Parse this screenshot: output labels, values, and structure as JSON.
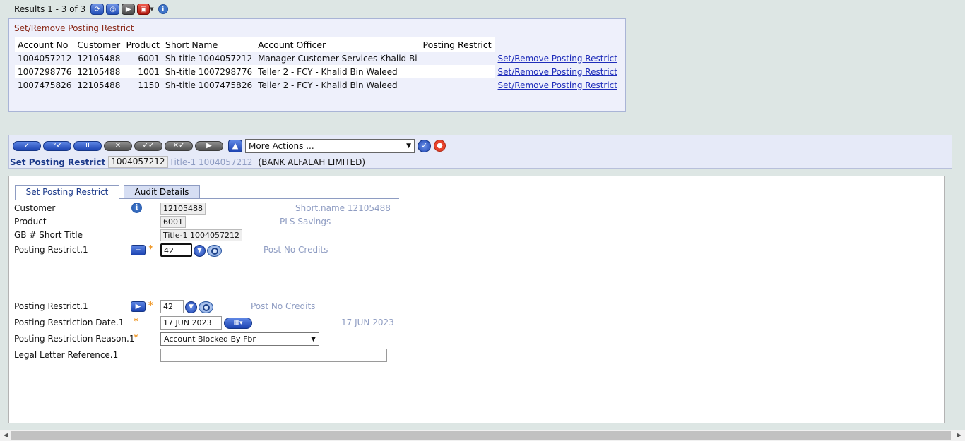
{
  "results": {
    "text": "Results 1 - 3 of 3",
    "icons": [
      "refresh-icon",
      "search-icon",
      "next-icon",
      "tools-icon",
      "info-icon"
    ]
  },
  "enquiry": {
    "title": "Set/Remove Posting Restrict",
    "columns": [
      "Account No",
      "Customer",
      "Product",
      "Short Name",
      "Account Officer",
      "Posting Restrict"
    ],
    "rows": [
      {
        "account_no": "1004057212",
        "customer": "12105488",
        "product": "6001",
        "short_name": "Sh-title 1004057212",
        "account_officer": "Manager Customer Services Khalid Bi",
        "posting_restrict": "",
        "action": "Set/Remove Posting Restrict"
      },
      {
        "account_no": "1007298776",
        "customer": "12105488",
        "product": "1001",
        "short_name": "Sh-title 1007298776",
        "account_officer": "Teller 2 - FCY - Khalid Bin Waleed",
        "posting_restrict": "",
        "action": "Set/Remove Posting Restrict"
      },
      {
        "account_no": "1007475826",
        "customer": "12105488",
        "product": "1150",
        "short_name": "Sh-title 1007475826",
        "account_officer": "Teller 2 - FCY - Khalid Bin Waleed",
        "posting_restrict": "",
        "action": "Set/Remove Posting Restrict"
      }
    ]
  },
  "toolbar": {
    "buttons": [
      {
        "name": "commit-button",
        "glyph": "✓",
        "style": "blue"
      },
      {
        "name": "validate-button",
        "glyph": "?✓",
        "style": "blue"
      },
      {
        "name": "hold-button",
        "glyph": "II",
        "style": "blue"
      },
      {
        "name": "delete-button",
        "glyph": "✕",
        "style": "gray"
      },
      {
        "name": "authorise-button",
        "glyph": "✓✓",
        "style": "gray"
      },
      {
        "name": "reverse-button",
        "glyph": "✕✓",
        "style": "gray"
      },
      {
        "name": "copy-button",
        "glyph": "▶",
        "style": "gray"
      }
    ],
    "more_actions": "More Actions ..."
  },
  "record": {
    "application": "Set Posting Restrict",
    "id": "1004057212",
    "title": "Title-1 1004057212",
    "company": "(BANK ALFALAH LIMITED)"
  },
  "tabs": [
    "Set Posting Restrict",
    "Audit Details"
  ],
  "form": {
    "customer": {
      "label": "Customer",
      "value": "12105488",
      "enrichment": "Short.name 12105488"
    },
    "product": {
      "label": "Product",
      "value": "6001",
      "enrichment": "PLS Savings"
    },
    "short_title": {
      "label": "GB # Short Title",
      "value": "Title-1 1004057212"
    },
    "posting_restrict_1": {
      "label": "Posting Restrict.1",
      "value": "42",
      "enrichment": "Post No Credits"
    },
    "posting_restrict_2": {
      "label": "Posting Restrict.1",
      "value": "42",
      "enrichment": "Post No Credits"
    },
    "restriction_date": {
      "label": "Posting Restriction Date.1",
      "value": "17 JUN 2023",
      "enrichment": "17 JUN 2023"
    },
    "restriction_reason": {
      "label": "Posting Restriction Reason.1",
      "value": "Account Blocked By Fbr"
    },
    "legal_letter": {
      "label": "Legal Letter Reference.1",
      "value": ""
    }
  },
  "required_marker": "*",
  "colors": {
    "accent": "#1c3a8a",
    "enrichment": "#8e9cc2",
    "required": "#ef9a2c",
    "link": "#1f2dba",
    "panel": "#eef0fb"
  }
}
